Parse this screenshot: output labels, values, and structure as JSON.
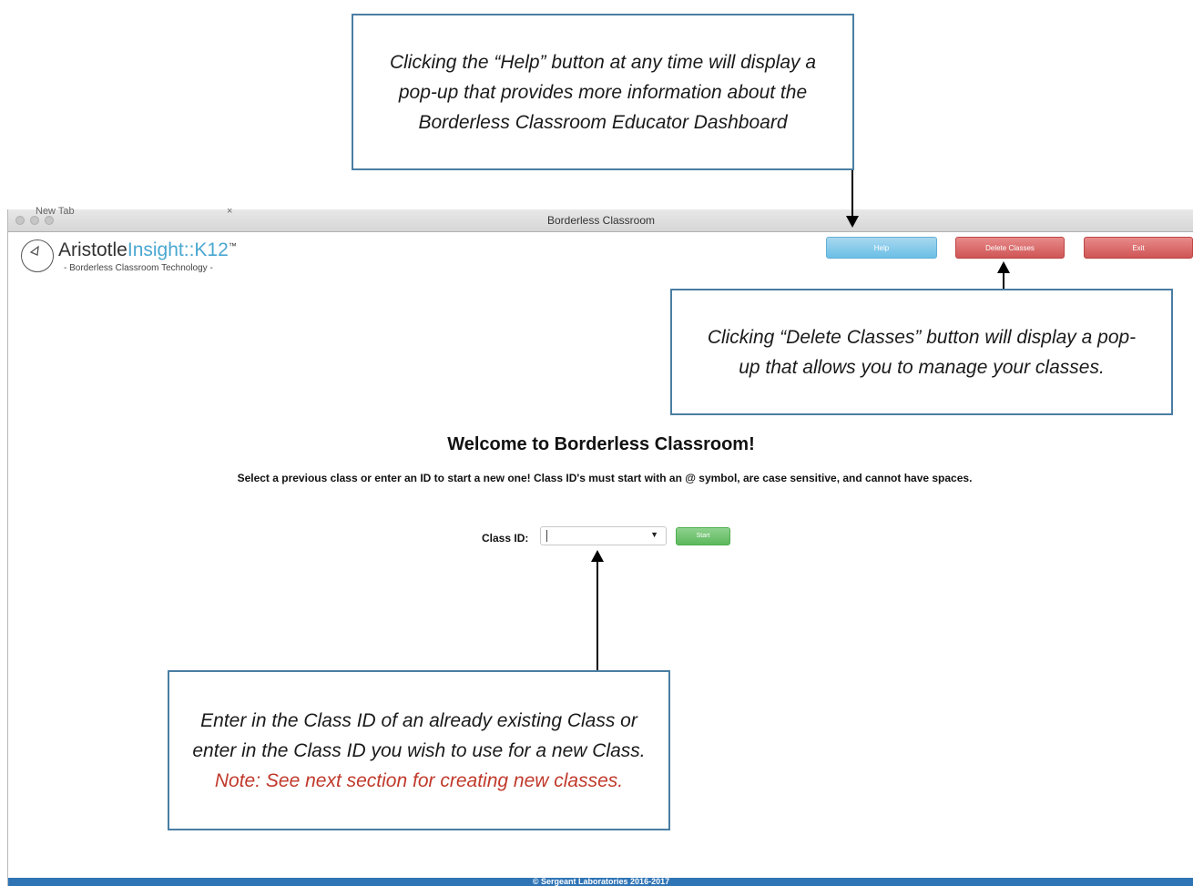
{
  "window": {
    "title": "Borderless Classroom",
    "ghost_tab": "New Tab",
    "ghost_tab2": "×"
  },
  "logo": {
    "name_part1": "Aristotle",
    "name_part2": "Insight::K12",
    "trademark": "™",
    "tagline": "- Borderless Classroom Technology -"
  },
  "header_buttons": {
    "help": "Help",
    "delete_classes": "Delete Classes",
    "exit": "Exit"
  },
  "main": {
    "welcome": "Welcome to Borderless Classroom!",
    "instructions": "Select a previous class or enter an ID to start a new one! Class ID's must start with an @ symbol, are case sensitive, and cannot have spaces.",
    "class_id_label": "Class ID:",
    "class_id_value": "",
    "dropdown_arrow": "▼",
    "start_label": "Start"
  },
  "footer": {
    "text": "© Sergeant Laboratories 2016-2017"
  },
  "callouts": {
    "help": "Clicking the “Help” button at any time will display a pop-up that provides more information about the Borderless Classroom Educator Dashboard",
    "delete": "Clicking “Delete Classes” button will display a pop-up that allows you to manage your classes.",
    "classid_main": "Enter in the Class ID of an already existing Class or enter in the Class ID you wish to use for a new Class.",
    "classid_note": "Note: See next section for creating new classes."
  },
  "colors": {
    "callout_border": "#4a7ea3",
    "note_text": "#c0392b",
    "help_button": "#6bbfe6",
    "delete_button": "#cf5555",
    "start_button": "#5cb85c",
    "footer": "#2f74b5",
    "logo_accent": "#4aa7d1"
  }
}
